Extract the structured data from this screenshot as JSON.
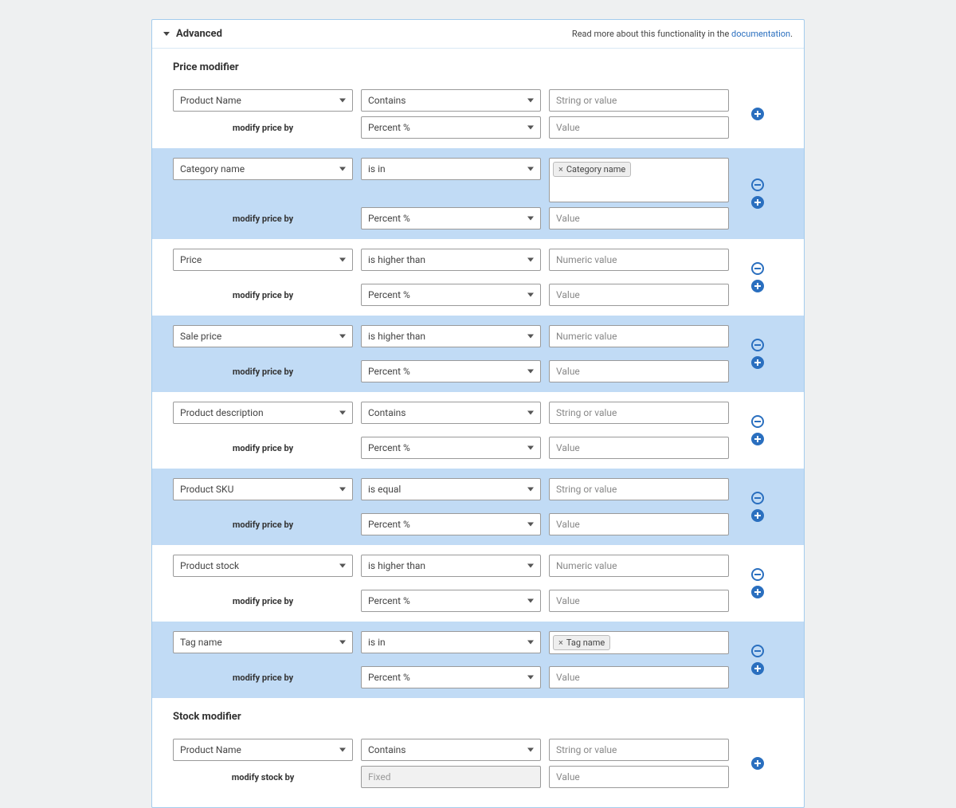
{
  "header": {
    "title": "Advanced",
    "help_prefix": "Read more about this functionality in the ",
    "help_link": "documentation",
    "help_suffix": "."
  },
  "labels": {
    "price_modifier": "Price modifier",
    "stock_modifier": "Stock modifier",
    "modify_price_by": "modify price by",
    "modify_stock_by": "modify stock by"
  },
  "operators": {
    "contains": "Contains",
    "is_in": "is in",
    "is_higher_than": "is higher than",
    "is_equal": "is equal"
  },
  "modifiers": {
    "percent": "Percent %",
    "fixed": "Fixed"
  },
  "placeholders": {
    "string_or_value": "String or value",
    "numeric_value": "Numeric value",
    "value": "Value"
  },
  "tags": {
    "category_name": "Category name",
    "tag_name": "Tag name"
  },
  "price_rules": [
    {
      "field": "Product Name",
      "operator": "contains",
      "value_kind": "text",
      "modifier": "percent",
      "actions": [
        "add"
      ],
      "alt": false
    },
    {
      "field": "Category name",
      "operator": "is_in",
      "value_kind": "tag_cat",
      "modifier": "percent",
      "actions": [
        "remove",
        "add"
      ],
      "alt": true
    },
    {
      "field": "Price",
      "operator": "is_higher_than",
      "value_kind": "numeric",
      "modifier": "percent",
      "actions": [
        "remove",
        "add"
      ],
      "alt": false
    },
    {
      "field": "Sale price",
      "operator": "is_higher_than",
      "value_kind": "numeric",
      "modifier": "percent",
      "actions": [
        "remove",
        "add"
      ],
      "alt": true
    },
    {
      "field": "Product description",
      "operator": "contains",
      "value_kind": "text",
      "modifier": "percent",
      "actions": [
        "remove",
        "add"
      ],
      "alt": false
    },
    {
      "field": "Product SKU",
      "operator": "is_equal",
      "value_kind": "text",
      "modifier": "percent",
      "actions": [
        "remove",
        "add"
      ],
      "alt": true
    },
    {
      "field": "Product stock",
      "operator": "is_higher_than",
      "value_kind": "numeric",
      "modifier": "percent",
      "actions": [
        "remove",
        "add"
      ],
      "alt": false
    },
    {
      "field": "Tag name",
      "operator": "is_in",
      "value_kind": "tag_tag",
      "modifier": "percent",
      "actions": [
        "remove",
        "add"
      ],
      "alt": true
    }
  ],
  "stock_rules": [
    {
      "field": "Product Name",
      "operator": "contains",
      "value_kind": "text",
      "modifier": "fixed",
      "modifier_disabled": true,
      "actions": [
        "add"
      ],
      "alt": false
    }
  ]
}
